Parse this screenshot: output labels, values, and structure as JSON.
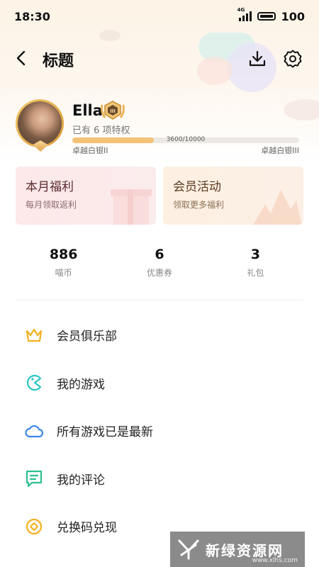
{
  "status": {
    "time": "18:30",
    "network": "4G",
    "battery": "100"
  },
  "header": {
    "title": "标题",
    "back_icon": "back-arrow-icon",
    "download_icon": "download-icon",
    "settings_icon": "gear-icon"
  },
  "profile": {
    "name": "Ella",
    "privileges": "已有 6 项特权",
    "progress_text": "3600/10000",
    "progress_fraction": 0.36,
    "level_current": "卓越白银II",
    "level_next": "卓越白银III",
    "rank_badge_text": "III"
  },
  "cards": [
    {
      "title": "本月福利",
      "subtitle": "每月领取返利"
    },
    {
      "title": "会员活动",
      "subtitle": "领取更多福利"
    }
  ],
  "stats": [
    {
      "value": "886",
      "label": "喵币"
    },
    {
      "value": "6",
      "label": "优惠券"
    },
    {
      "value": "3",
      "label": "礼包"
    }
  ],
  "menu": [
    {
      "label": "会员俱乐部",
      "icon": "crown-icon",
      "color": "#f2b01e"
    },
    {
      "label": "我的游戏",
      "icon": "game-icon",
      "color": "#26c6c6"
    },
    {
      "label": "所有游戏已是最新",
      "icon": "cloud-icon",
      "color": "#3a86e8"
    },
    {
      "label": "我的评论",
      "icon": "comment-icon",
      "color": "#2ec08c"
    },
    {
      "label": "兑换码兑现",
      "icon": "coin-icon",
      "color": "#f2b01e"
    }
  ],
  "watermark": {
    "text": "新绿资源网",
    "url": "www.xlhs.com"
  }
}
